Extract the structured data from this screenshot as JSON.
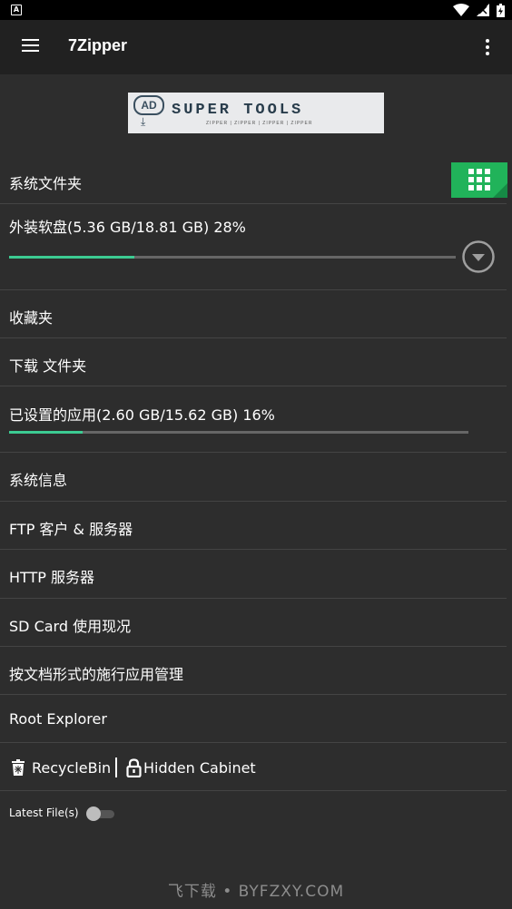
{
  "status_bar": {
    "left_icon": "A"
  },
  "app_bar": {
    "title": "7Zipper"
  },
  "ad": {
    "badge": "AD",
    "title": "SUPER TOOLS",
    "subtitle": "ZIPPER | ZIPPER | ZIPPER | ZIPPER"
  },
  "items": {
    "system_folder": "系统文件夹",
    "external_storage": "外装软盘(5.36 GB/18.81 GB) 28%",
    "external_storage_progress": 0.28,
    "favorites": "收藏夹",
    "download_folder": "下载 文件夹",
    "installed_apps": "已设置的应用(2.60 GB/15.62 GB) 16%",
    "installed_apps_progress": 0.16,
    "system_info": "系统信息",
    "ftp": "FTP 客户 & 服务器",
    "http": "HTTP 服务器",
    "sd_card": "SD Card 使用现况",
    "app_manager": "按文档形式的施行应用管理",
    "root_explorer": "Root Explorer",
    "recycle_bin": "RecycleBin",
    "hidden_cabinet": "Hidden Cabinet",
    "latest_files": "Latest File(s)",
    "latest_files_enabled": false
  },
  "watermark": "飞下载 • BYFZXY.COM",
  "colors": {
    "accent": "#3ccb92",
    "grid_button": "#21b35a",
    "background": "#2d2d2d",
    "app_bar": "#212121"
  }
}
